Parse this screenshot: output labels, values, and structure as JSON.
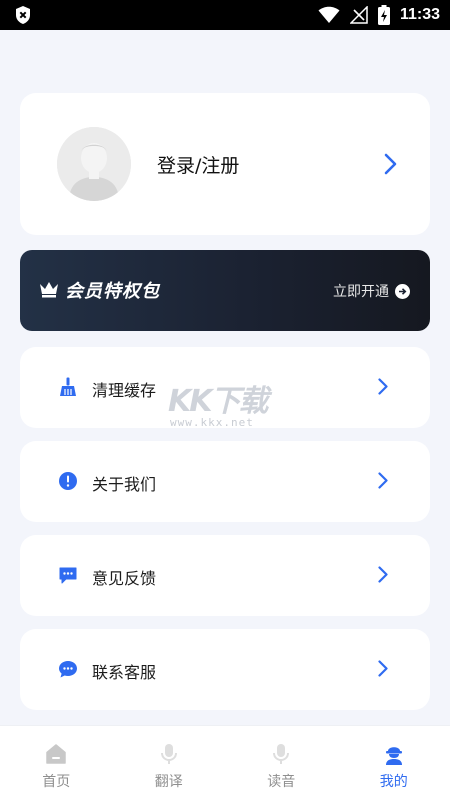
{
  "status_bar": {
    "time": "11:33"
  },
  "profile": {
    "login_label": "登录/注册"
  },
  "vip": {
    "title": "会员特权包",
    "action": "立即开通"
  },
  "menu": [
    {
      "label": "清理缓存",
      "icon": "broom-icon"
    },
    {
      "label": "关于我们",
      "icon": "info-icon"
    },
    {
      "label": "意见反馈",
      "icon": "feedback-icon"
    },
    {
      "label": "联系客服",
      "icon": "chat-icon"
    }
  ],
  "watermark": {
    "brand": "KK下载",
    "url": "www.kkx.net"
  },
  "bottom_nav": [
    {
      "label": "首页",
      "icon": "home-icon"
    },
    {
      "label": "翻译",
      "icon": "microphone-icon"
    },
    {
      "label": "读音",
      "icon": "microphone-icon"
    },
    {
      "label": "我的",
      "icon": "user-icon",
      "active": true
    }
  ],
  "colors": {
    "accent": "#2f6bf0",
    "vip_bg": "#1b2232"
  }
}
